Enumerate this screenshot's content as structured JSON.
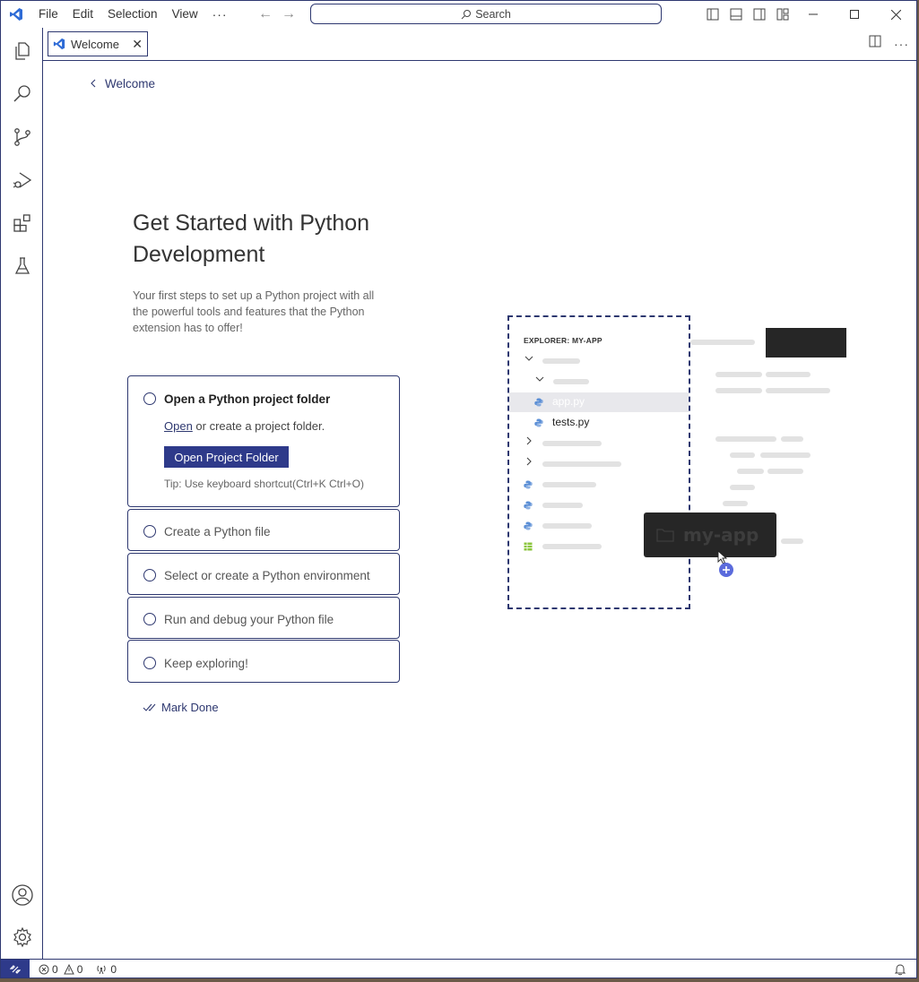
{
  "titlebar": {
    "menu": [
      "File",
      "Edit",
      "Selection",
      "View"
    ],
    "more": "···",
    "search_label": "Search"
  },
  "tab": {
    "label": "Welcome",
    "close": "✕"
  },
  "walkthrough": {
    "back_label": "Welcome",
    "heading": "Get Started with Python Development",
    "subtext": "Your first steps to set up a Python project with all the powerful tools and features that the Python extension has to offer!",
    "steps": [
      {
        "title": "Open a Python project folder",
        "expanded": true
      },
      {
        "title": "Create a Python file"
      },
      {
        "title": "Select or create a Python environment"
      },
      {
        "title": "Run and debug your Python file"
      },
      {
        "title": "Keep exploring!"
      }
    ],
    "step1": {
      "desc_link": "Open",
      "desc_rest": " or create a project folder.",
      "button": "Open Project Folder",
      "tip": "Tip: Use keyboard shortcut(Ctrl+K Ctrl+O)"
    },
    "mark_done": "Mark Done"
  },
  "illustration": {
    "explorer_title": "EXPLORER: MY-APP",
    "file_selected": "app.py",
    "file_2": "tests.py",
    "drag_label": "my-app"
  },
  "statusbar": {
    "errors": "0",
    "warnings": "0",
    "ports": "0"
  },
  "colors": {
    "accent": "#2e3870",
    "button": "#2e3a8a"
  }
}
